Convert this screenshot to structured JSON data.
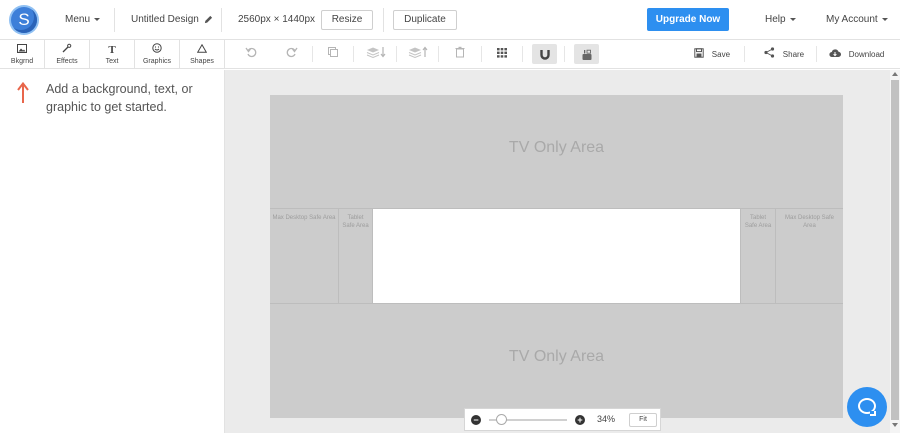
{
  "app": {
    "logo_letter": "S",
    "brand_color": "#2d8ff0"
  },
  "topbar": {
    "menu_label": "Menu",
    "design_name": "Untitled Design",
    "dimensions": "2560px × 1440px",
    "resize_label": "Resize",
    "duplicate_label": "Duplicate",
    "upgrade_label": "Upgrade Now",
    "help_label": "Help",
    "account_label": "My Account"
  },
  "tools": [
    {
      "label": "Bkgrnd",
      "icon": "image-icon"
    },
    {
      "label": "Effects",
      "icon": "wand-icon"
    },
    {
      "label": "Text",
      "icon": "text-icon"
    },
    {
      "label": "Graphics",
      "icon": "smiley-icon"
    },
    {
      "label": "Shapes",
      "icon": "triangle-icon"
    }
  ],
  "canvas_toolbar": {
    "icons": [
      "undo-icon",
      "redo-icon",
      "copy-icon",
      "send-backward-icon",
      "bring-forward-icon",
      "trash-icon",
      "grid-icon",
      "magnet-icon",
      "youtube-icon"
    ],
    "save_label": "Save",
    "share_label": "Share",
    "download_label": "Download"
  },
  "hint": {
    "text": "Add a background, text, or graphic to get started.",
    "arrow_color": "#e8664b"
  },
  "design": {
    "tv_top": "TV Only Area",
    "tv_bottom": "TV Only Area",
    "desktop_left": "Max Desktop Safe Area",
    "tablet_left": "Tablet Safe Area",
    "tablet_right": "Tablet Safe Area",
    "desktop_right": "Max Desktop Safe Area"
  },
  "zoom": {
    "percent": "34%",
    "fit_label": "Fit",
    "level": 0.34
  }
}
